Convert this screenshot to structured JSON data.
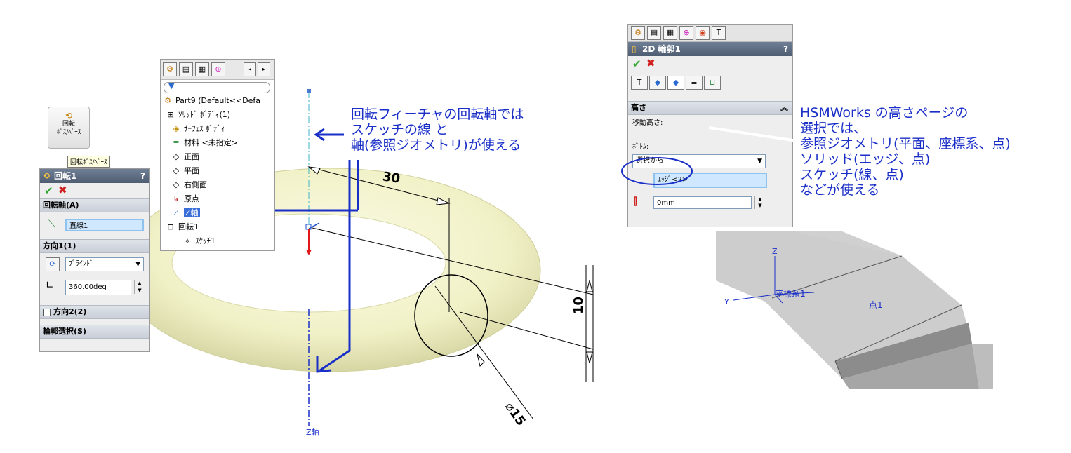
{
  "toolbar_button": {
    "label_line1": "回転",
    "label_line2": "ﾎﾞｽ/ﾍﾞｰｽ",
    "tooltip": "回転ﾎﾞｽ/ﾍﾞｰｽ"
  },
  "revolve_panel": {
    "title": "回転1",
    "help": "?",
    "axis_group": "回転軸(A)",
    "axis_value": "直線1",
    "dir1_group": "方向1(1)",
    "dir1_type": "ﾌﾞﾗｲﾝﾄﾞ",
    "angle_value": "360.00deg",
    "dir2_group": "方向2(2)",
    "contour_group": "輪郭選択(S)"
  },
  "feature_tree": {
    "part": "Part9  (Default<<Defa",
    "items": [
      {
        "icon": "⊞",
        "label": "ｿﾘｯﾄﾞ ﾎﾞﾃﾞｨ(1)"
      },
      {
        "icon": "◈",
        "label": "ｻｰﾌｪｽ ﾎﾞﾃﾞｨ"
      },
      {
        "icon": "≡",
        "label": "材料 <未指定>"
      },
      {
        "icon": "◇",
        "label": "正面"
      },
      {
        "icon": "◇",
        "label": "平面"
      },
      {
        "icon": "◇",
        "label": "右側面"
      },
      {
        "icon": "↳",
        "label": "原点"
      },
      {
        "icon": "⟋",
        "label": "Z軸"
      },
      {
        "icon": "⊟",
        "label": "回転1"
      },
      {
        "icon": "⟡",
        "label": "ｽｹｯﾁ1"
      }
    ]
  },
  "annotation_left": {
    "line1": "回転フィーチャの回転軸では",
    "line2": "スケッチの線 と",
    "line3": "軸(参照ジオメトリ)が使える"
  },
  "dimensions": {
    "d30": "30",
    "d10": "10",
    "d15": "⌀15",
    "zaxis": "Z軸"
  },
  "hsm_panel": {
    "title": "2D 輪郭1",
    "help": "?",
    "height_group": "高さ",
    "move_height_label": "移動高さ:",
    "bottom_label": "ﾎﾞﾄﾑ:",
    "bottom_combo": "選択から",
    "edge_value": "ｴｯｼﾞ<2>",
    "offset_value": "0mm"
  },
  "annotation_right": {
    "line1": "HSMWorks の高さページの",
    "line2": "選択では、",
    "line3": "参照ジオメトリ(平面、座標系、点)",
    "line4": "ソリッド(エッジ、点)",
    "line5": "スケッチ(線、点)",
    "line6": "などが使える"
  },
  "viewport_right": {
    "z": "Z",
    "y": "Y",
    "coord": "座標系1",
    "point": "点1"
  },
  "colors": {
    "annotation": "#1a2fc8",
    "torus": "#f4f4cf",
    "accent": "#2fa52f"
  }
}
